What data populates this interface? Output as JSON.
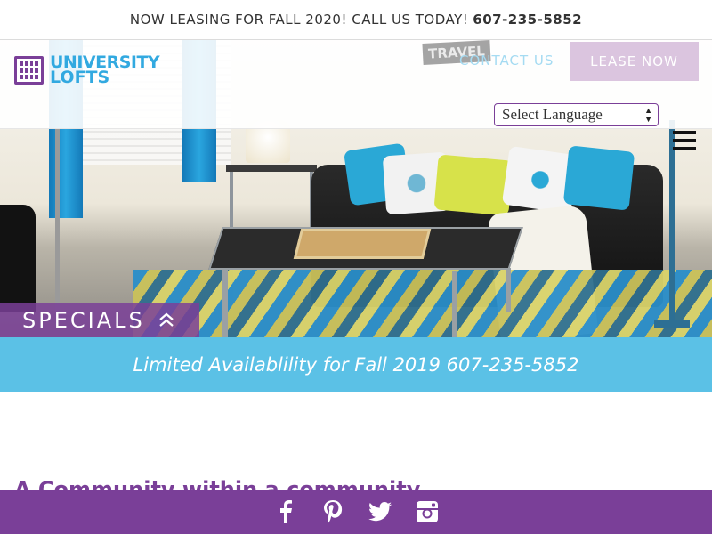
{
  "announcement": {
    "text": "NOW LEASING FOR FALL 2020! CALL US TODAY!",
    "phone": "607-235-5852"
  },
  "logo": {
    "line1": "UNIVERSITY",
    "line2": "LOFTS"
  },
  "background_sign": "TRAVEL",
  "nav": {
    "contact": "CONTACT US",
    "lease": "LEASE NOW"
  },
  "language_select": {
    "selected": "Select Language"
  },
  "specials": {
    "label": "SPECIALS"
  },
  "banner": {
    "text": "Limited Availablility for Fall 2019 607-235-5852"
  },
  "section_heading": "A Community within a community",
  "social": {
    "icons": [
      "facebook-icon",
      "pinterest-icon",
      "twitter-icon",
      "instagram-icon"
    ]
  },
  "colors": {
    "brand_purple": "#7a3f98",
    "brand_blue": "#32a9e0",
    "banner_blue": "#5bc1e6",
    "lease_button": "#dbc5df"
  }
}
